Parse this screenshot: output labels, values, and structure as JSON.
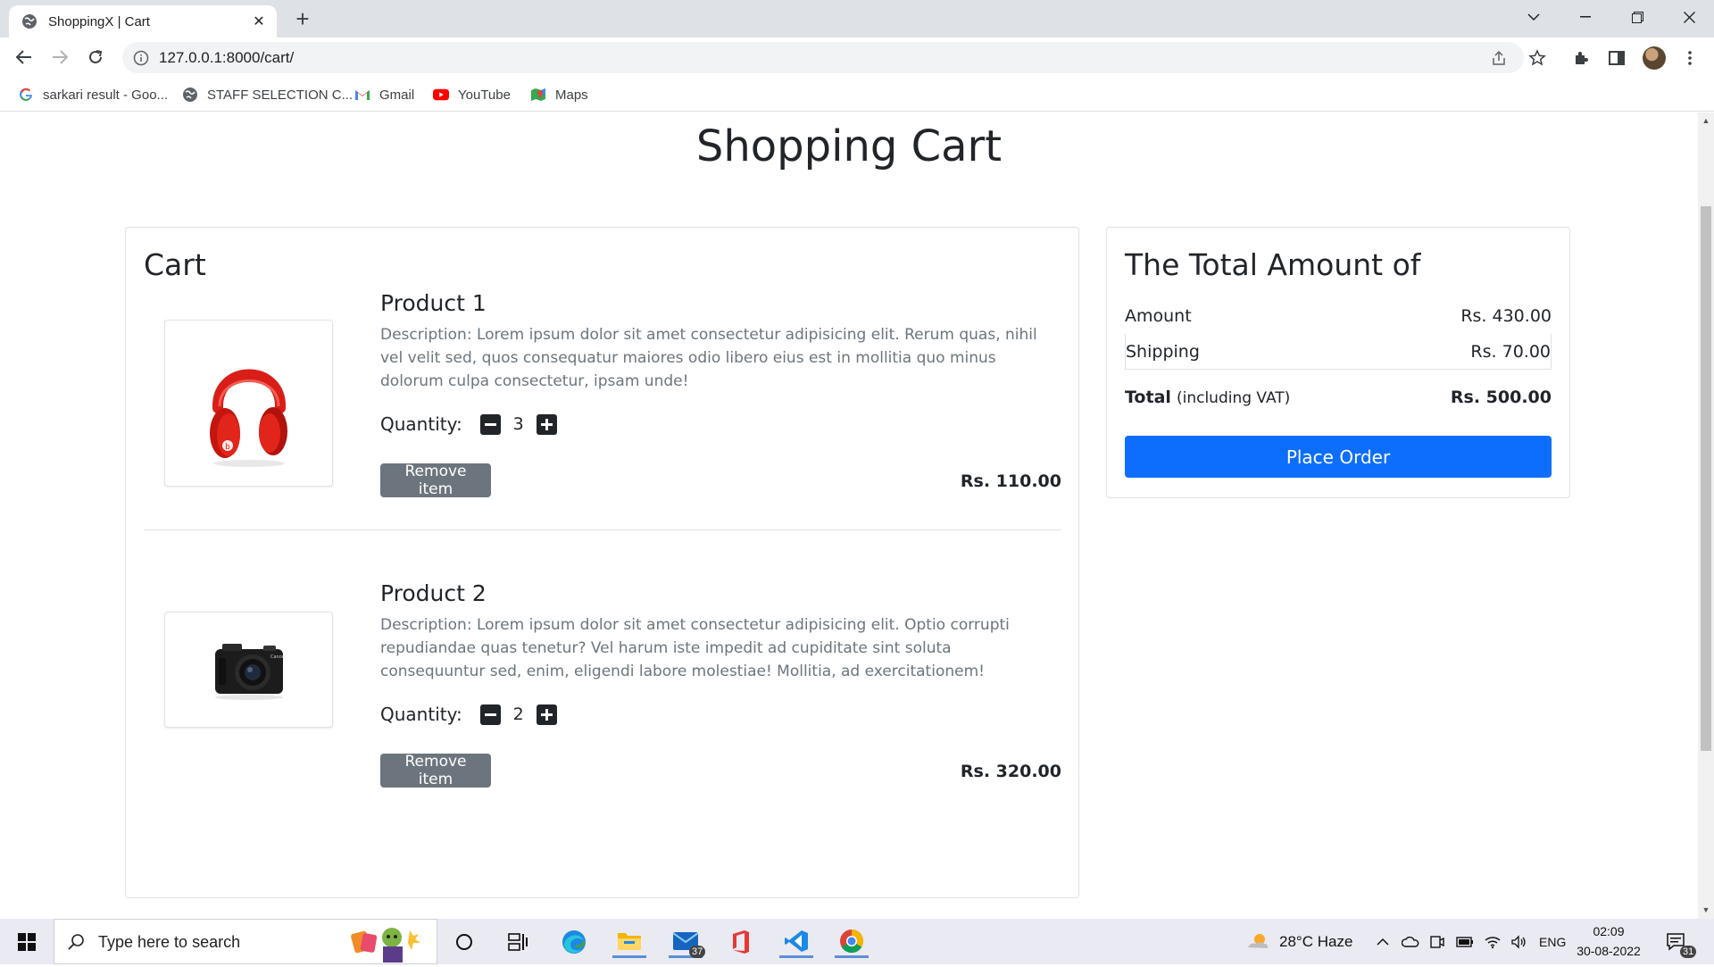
{
  "browser": {
    "tab_title": "ShoppingX | Cart",
    "url": "127.0.0.1:8000/cart/",
    "bookmarks": [
      {
        "label": "sarkari result - Goo...",
        "icon": "google-icon"
      },
      {
        "label": "STAFF SELECTION C...",
        "icon": "globe-icon"
      },
      {
        "label": "Gmail",
        "icon": "gmail-icon"
      },
      {
        "label": "YouTube",
        "icon": "youtube-icon"
      },
      {
        "label": "Maps",
        "icon": "maps-icon"
      }
    ]
  },
  "page": {
    "title": "Shopping Cart",
    "cart": {
      "heading": "Cart",
      "quantity_label": "Quantity:",
      "remove_label": "Remove item",
      "items": [
        {
          "name": "Product 1",
          "description": "Description: Lorem ipsum dolor sit amet consectetur adipisicing elit. Rerum quas, nihil vel velit sed, quos consequatur maiores odio libero eius est in mollitia quo minus dolorum culpa consectetur, ipsam unde!",
          "quantity": "3",
          "price": "Rs. 110.00",
          "image": "red-headphones-image"
        },
        {
          "name": "Product 2",
          "description": "Description: Lorem ipsum dolor sit amet consectetur adipisicing elit. Optio corrupti repudiandae quas tenetur? Vel harum iste impedit ad cupiditate sint soluta consequuntur sed, enim, eligendi labore molestiae! Mollitia, ad exercitationem!",
          "quantity": "2",
          "price": "Rs. 320.00",
          "image": "camera-image"
        }
      ]
    },
    "summary": {
      "heading": "The Total Amount of",
      "amount_label": "Amount",
      "amount_value": "Rs. 430.00",
      "shipping_label": "Shipping",
      "shipping_value": "Rs. 70.00",
      "total_label": "Total",
      "total_note": "(including VAT)",
      "total_value": "Rs. 500.00",
      "place_order_label": "Place Order"
    }
  },
  "taskbar": {
    "search_placeholder": "Type here to search",
    "weather": "28°C  Haze",
    "language": "ENG",
    "time": "02:09",
    "date": "30-08-2022",
    "mail_badge": "37",
    "notification_badge": "31"
  },
  "colors": {
    "primary": "#0d6efd",
    "secondary": "#6c757d",
    "text": "#212529"
  }
}
